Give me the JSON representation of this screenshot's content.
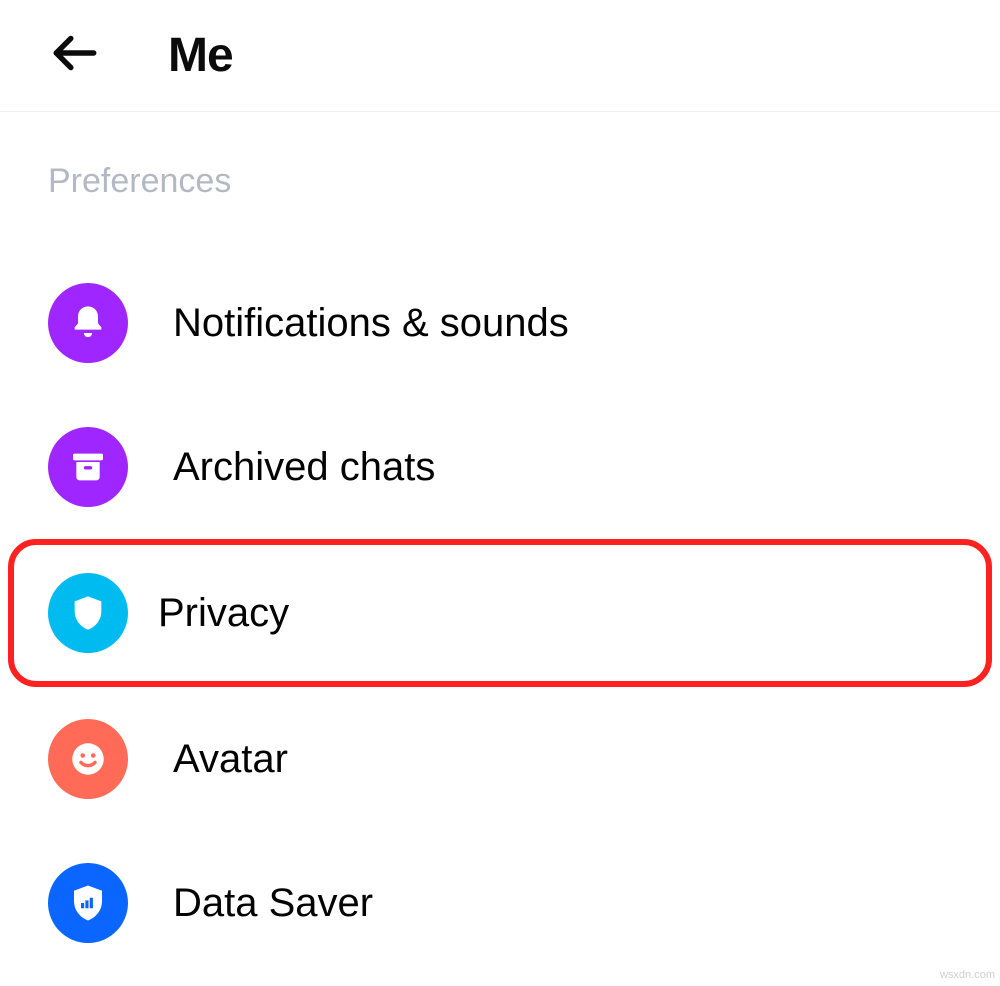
{
  "header": {
    "title": "Me"
  },
  "section": {
    "label": "Preferences"
  },
  "items": [
    {
      "label": "Notifications & sounds"
    },
    {
      "label": "Archived chats"
    },
    {
      "label": "Privacy"
    },
    {
      "label": "Avatar"
    },
    {
      "label": "Data Saver"
    }
  ],
  "watermark": "wsxdn.com"
}
